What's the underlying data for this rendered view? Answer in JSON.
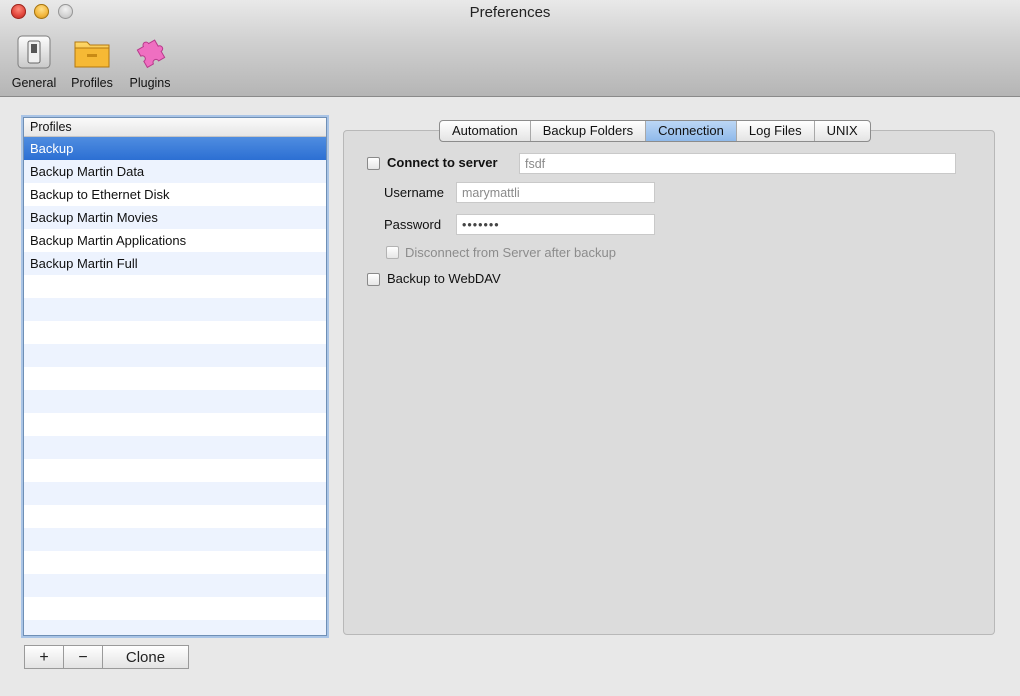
{
  "window": {
    "title": "Preferences"
  },
  "toolbar": {
    "items": [
      {
        "label": "General",
        "icon": "switch-panel-icon"
      },
      {
        "label": "Profiles",
        "icon": "folder-icon"
      },
      {
        "label": "Plugins",
        "icon": "puzzle-piece-icon"
      }
    ]
  },
  "profiles": {
    "header": "Profiles",
    "items": [
      "Backup",
      "Backup Martin Data",
      "Backup to Ethernet Disk",
      "Backup Martin Movies",
      "Backup Martin Applications",
      "Backup Martin Full"
    ],
    "selected_index": 0
  },
  "list_buttons": {
    "add": "+",
    "remove": "−",
    "clone": "Clone"
  },
  "tabs": {
    "items": [
      "Automation",
      "Backup Folders",
      "Connection",
      "Log Files",
      "UNIX"
    ],
    "active": "Connection"
  },
  "connection": {
    "connect_label": "Connect to server",
    "connect_checked": false,
    "server_value": "fsdf",
    "username_label": "Username",
    "username_value": "marymattli",
    "password_label": "Password",
    "password_value": "•••••••",
    "disconnect_label": "Disconnect from Server after backup",
    "disconnect_checked": false,
    "webdav_label": "Backup to WebDAV",
    "webdav_checked": false
  },
  "colors": {
    "selection": "#2c6fd3",
    "active_tab": "#8fb9ea",
    "stripe": "#edf3fe"
  }
}
